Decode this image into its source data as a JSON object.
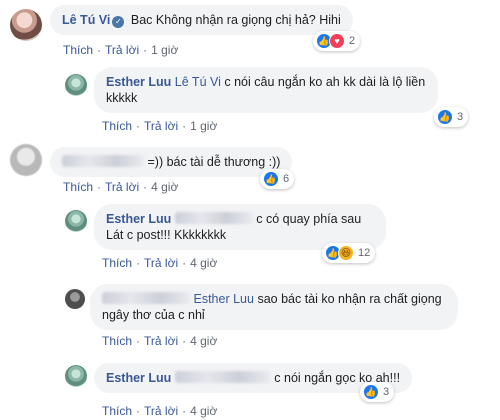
{
  "actions": {
    "like": "Thích",
    "reply": "Trả lời",
    "dot": "·"
  },
  "comments": [
    {
      "author": "Lê Tú Vi",
      "text": "Bac Không nhận ra giọng chị hả? Hihi",
      "time": "1 giờ",
      "reactions": {
        "icons": [
          "like",
          "love"
        ],
        "count": "2"
      }
    },
    {
      "author": "Esther Luu",
      "mention": "Lê Tú Vi",
      "text_line1": "c nói câu ngắn ko ah kk dài là lộ liền",
      "text_line2": "kkkkk",
      "time": "1 giờ",
      "reactions": {
        "icons": [
          "like"
        ],
        "count": "3"
      }
    },
    {
      "text": "=)) bác tài dễ thương :))",
      "time": "4 giờ",
      "reactions": {
        "icons": [
          "like"
        ],
        "count": "6"
      }
    },
    {
      "author": "Esther Luu",
      "text_line1": "c có quay phía sau",
      "text_line2": "Lát c post!!! Kkkkkkkk",
      "time": "4 giờ",
      "reactions": {
        "icons": [
          "like",
          "haha"
        ],
        "count": "12"
      }
    },
    {
      "mention": "Esther Luu",
      "text_line1": "sao bác tài ko nhận ra chất giọng",
      "text_line2": "ngây thơ của c nhỉ",
      "time": "4 giờ"
    },
    {
      "author": "Esther Luu",
      "text": "c nói ngắn gọc ko ah!!!",
      "time": "4 giờ",
      "reactions": {
        "icons": [
          "like"
        ],
        "count": "3"
      }
    }
  ]
}
